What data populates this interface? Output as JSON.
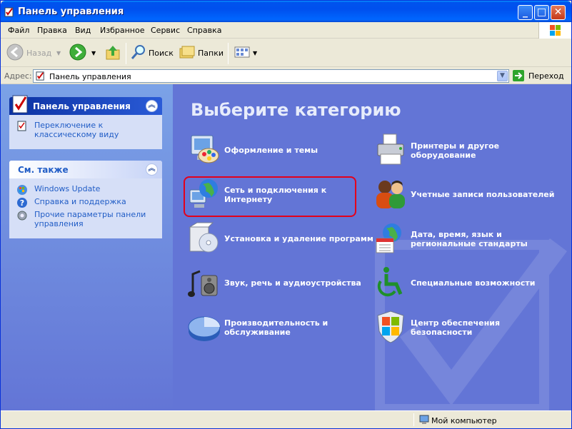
{
  "window": {
    "title": "Панель управления"
  },
  "menu": [
    "Файл",
    "Правка",
    "Вид",
    "Избранное",
    "Сервис",
    "Справка"
  ],
  "toolbar": {
    "back": "Назад",
    "search": "Поиск",
    "folders": "Папки"
  },
  "address": {
    "label": "Адрес:",
    "value": "Панель управления",
    "go": "Переход"
  },
  "left": {
    "main_panel": {
      "title": "Панель управления",
      "link": "Переключение к классическому виду"
    },
    "see_also": {
      "title": "См. также",
      "links": [
        "Windows Update",
        "Справка и поддержка",
        "Прочие параметры панели управления"
      ]
    }
  },
  "main": {
    "heading": "Выберите категорию",
    "categories_left": [
      {
        "label": "Оформление и темы",
        "icon": "appearance-icon"
      },
      {
        "label": "Сеть и подключения к Интернету",
        "icon": "network-icon"
      },
      {
        "label": "Установка и удаление программ",
        "icon": "add-remove-programs-icon"
      },
      {
        "label": "Звук, речь и аудиоустройства",
        "icon": "sound-icon"
      },
      {
        "label": "Производительность и обслуживание",
        "icon": "performance-icon"
      }
    ],
    "categories_right": [
      {
        "label": "Принтеры и другое оборудование",
        "icon": "printers-icon"
      },
      {
        "label": "Учетные записи пользователей",
        "icon": "user-accounts-icon"
      },
      {
        "label": "Дата, время, язык и региональные стандарты",
        "icon": "date-time-icon"
      },
      {
        "label": "Специальные возможности",
        "icon": "accessibility-icon"
      },
      {
        "label": "Центр обеспечения безопасности",
        "icon": "security-center-icon"
      }
    ]
  },
  "status": {
    "text": "Мой компьютер"
  },
  "colors": {
    "accent": "#6375d6",
    "highlight": "#e3001b"
  }
}
